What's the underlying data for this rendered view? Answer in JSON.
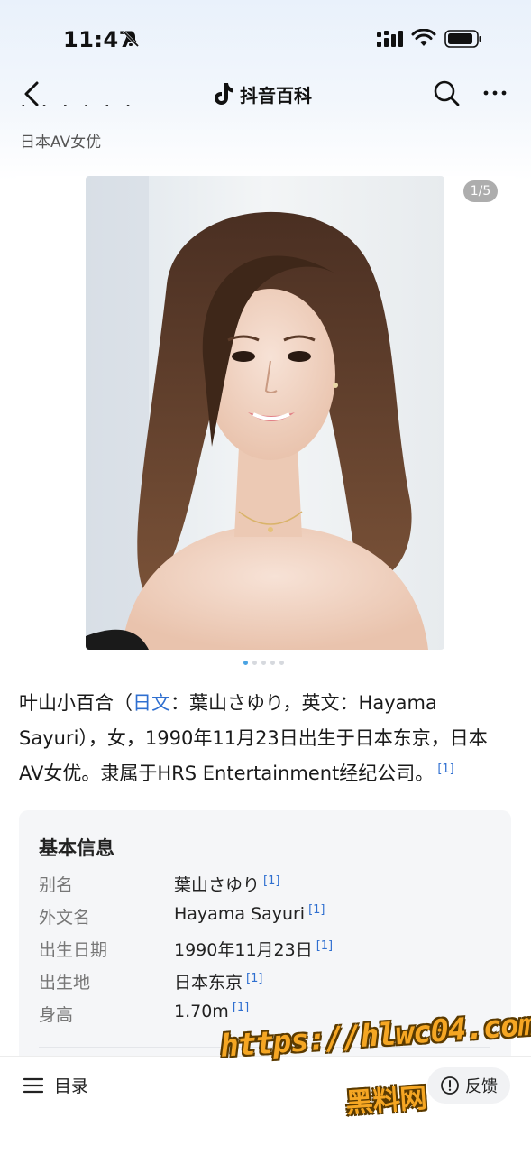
{
  "status_bar": {
    "time": "11:47"
  },
  "nav": {
    "brand": "抖音百科"
  },
  "page": {
    "subtitle": "日本AV女优"
  },
  "gallery": {
    "counter": "1/5"
  },
  "summary": {
    "t1": "叶山小百合（",
    "link": "日文",
    "t2": "：葉山さゆり，英文：Hayama Sayuri），女，1990年11月23日出生于日本东京，日本AV女优。隶属于HRS Entertainment经纪公司。",
    "ref": "[1]"
  },
  "info": {
    "title": "基本信息",
    "rows": [
      {
        "label": "别名",
        "value": "葉山さゆり",
        "ref": "[1]"
      },
      {
        "label": "外文名",
        "value": "Hayama Sayuri",
        "ref": "[1]"
      },
      {
        "label": "出生日期",
        "value": "1990年11月23日",
        "ref": "[1]"
      },
      {
        "label": "出生地",
        "value": "日本东京",
        "ref": "[1]"
      },
      {
        "label": "身高",
        "value": "1.70m",
        "ref": "[1]"
      }
    ]
  },
  "bottom": {
    "toc": "目录",
    "feedback": "反馈"
  },
  "watermark": {
    "url": "https://hlwc04.com",
    "site": "黑料网"
  },
  "colors": {
    "accent": "#2f6fd0",
    "card_bg": "#f5f6f8",
    "watermark": "#f5a623"
  }
}
